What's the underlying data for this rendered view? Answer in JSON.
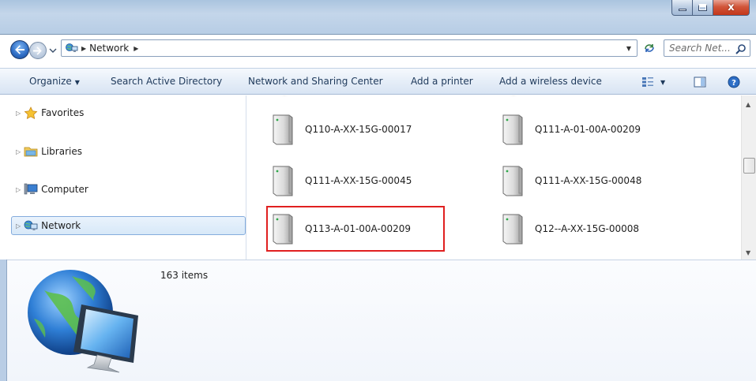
{
  "window": {
    "caption_buttons": {
      "minimize": "minimize",
      "maximize": "maximize",
      "close": "x"
    }
  },
  "address": {
    "path": [
      "Network"
    ],
    "search_placeholder": "Search Net..."
  },
  "commandbar": {
    "organize": "Organize",
    "search_ad": "Search Active Directory",
    "network_sharing_center": "Network and Sharing Center",
    "add_printer": "Add a printer",
    "add_wireless": "Add a wireless device"
  },
  "nav": {
    "items": [
      {
        "label": "Favorites",
        "icon": "star-icon"
      },
      {
        "label": "Libraries",
        "icon": "library-icon"
      },
      {
        "label": "Computer",
        "icon": "computer-icon"
      },
      {
        "label": "Network",
        "icon": "network-icon",
        "selected": true
      }
    ]
  },
  "content": {
    "items": [
      {
        "label": "Q110-A-XX-15G-00017"
      },
      {
        "label": "Q111-A-01-00A-00209"
      },
      {
        "label": "Q111-A-XX-15G-00045"
      },
      {
        "label": "Q111-A-XX-15G-00048"
      },
      {
        "label": "Q113-A-01-00A-00209",
        "highlighted": true
      },
      {
        "label": "Q12--A-XX-15G-00008"
      }
    ]
  },
  "details": {
    "count": "163 items"
  },
  "colors": {
    "highlight_box": "#e02020",
    "selection_bg": "#d7e8f8",
    "command_text": "#1e395b"
  }
}
